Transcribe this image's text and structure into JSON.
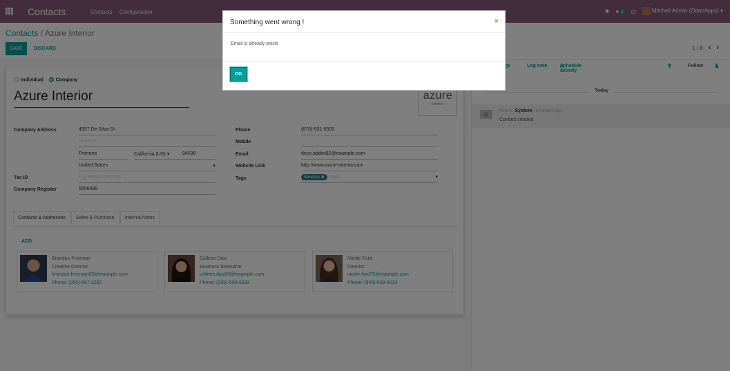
{
  "navbar": {
    "brand": "Contacts",
    "menu": [
      "Contacts",
      "Configuration"
    ],
    "chat_count": "2",
    "user": "Mitchell Admin (OdooApps)",
    "caret": "▾"
  },
  "control": {
    "breadcrumb_root": "Contacts",
    "breadcrumb_sep": " / ",
    "breadcrumb_current": "Azure Interior",
    "save_label": "SAVE",
    "discard_label": "DISCARD",
    "pager": "1 / 8"
  },
  "form": {
    "type_individual": "Individual",
    "type_company": "Company",
    "name": "Azure Interior",
    "logo_big": "azure",
    "logo_small": "— interior —",
    "labels": {
      "address": "Company Address",
      "tax_id": "Tax ID",
      "company_register": "Company Register",
      "phone": "Phone",
      "mobile": "Mobile",
      "email": "Email",
      "website": "Website Link",
      "tags": "Tags"
    },
    "street": "4557 De Silva St",
    "street2_placeholder": "Street 2...",
    "city": "Fremont",
    "state": "California (US)",
    "zip": "94538",
    "country": "United States",
    "tax_placeholder": "e.g. BE0477472701",
    "company_register": "5556489",
    "phone": "(870)-931-0505",
    "email": "deco.addict82@example.com",
    "website": "http://www.azure-interior.com",
    "tag": "Services",
    "tags_placeholder": "Tags..."
  },
  "tabs": [
    "Contacts & Addresses",
    "Sales & Purchase",
    "Internal Notes"
  ],
  "add_label": "ADD",
  "contacts": [
    {
      "name": "Brandon Freeman",
      "title": "Creative Director",
      "email": "brandon.freeman55@example.com",
      "phone": "Phone: (355)-687-3262"
    },
    {
      "name": "Colleen Diaz",
      "title": "Business Executive",
      "email": "colleen.diaz83@example.com",
      "phone": "Phone: (255)-595-8393"
    },
    {
      "name": "Nicole Ford",
      "title": "Director",
      "email": "nicole.ford75@example.com",
      "phone": "Phone: (946)-638-6034"
    }
  ],
  "chatter": {
    "send_message": "age",
    "log_note": "Log note",
    "schedule": "Schedule activity",
    "attach_count": "0",
    "follow": "Follow",
    "followers": "1",
    "today": "Today",
    "note_prefix": "Note by",
    "note_author": "System",
    "note_time": "- 3 minutes ago",
    "note_body": "Contact created"
  },
  "dialog": {
    "title": "Something went wrong !",
    "message": "Email is already exists",
    "ok_label": "OK"
  },
  "colors": {
    "brand": "#875A7B",
    "accent": "#00A09D"
  }
}
